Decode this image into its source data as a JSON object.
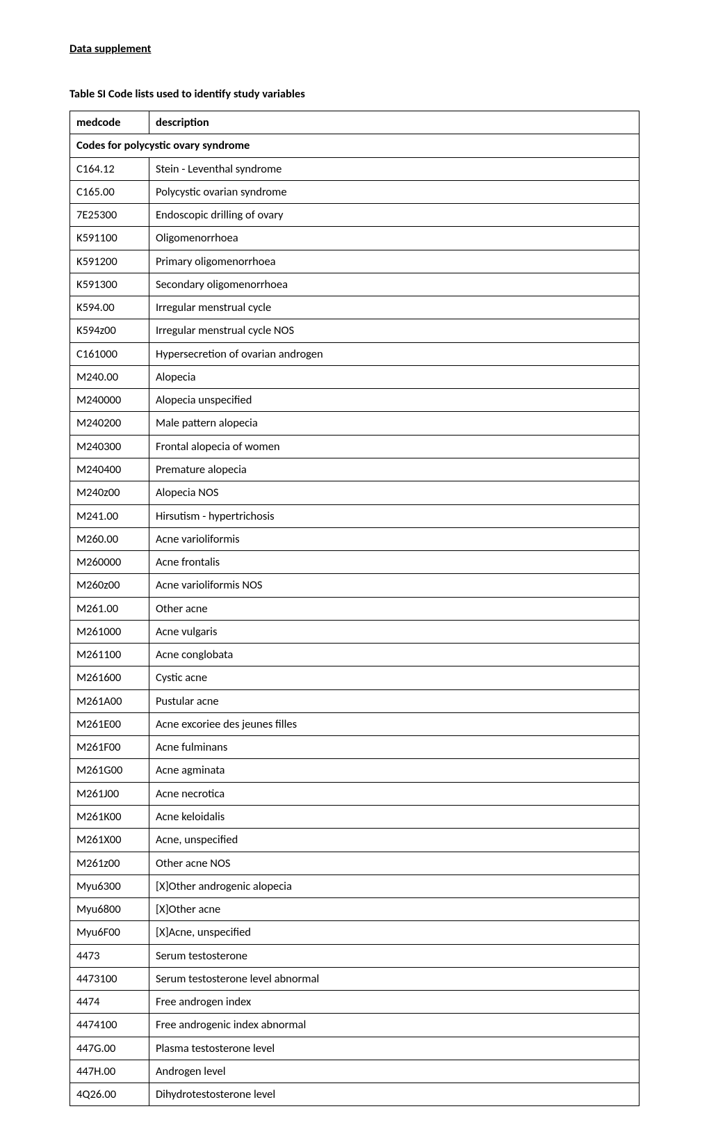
{
  "heading": "Data supplement",
  "table_title": "Table SI Code lists used to identify study variables",
  "header": {
    "col1": "medcode",
    "col2": "description"
  },
  "section_header": "Codes for polycystic ovary syndrome",
  "rows": [
    {
      "code": "C164.12",
      "desc": "Stein - Leventhal syndrome"
    },
    {
      "code": "C165.00",
      "desc": "Polycystic ovarian syndrome"
    },
    {
      "code": "7E25300",
      "desc": "Endoscopic drilling of ovary"
    },
    {
      "code": "K591100",
      "desc": "Oligomenorrhoea"
    },
    {
      "code": "K591200",
      "desc": "Primary oligomenorrhoea"
    },
    {
      "code": "K591300",
      "desc": "Secondary oligomenorrhoea"
    },
    {
      "code": "K594.00",
      "desc": "Irregular menstrual cycle"
    },
    {
      "code": "K594z00",
      "desc": "Irregular menstrual cycle NOS"
    },
    {
      "code": "C161000",
      "desc": "Hypersecretion of ovarian androgen"
    },
    {
      "code": "M240.00",
      "desc": "Alopecia"
    },
    {
      "code": "M240000",
      "desc": "Alopecia unspecified"
    },
    {
      "code": "M240200",
      "desc": "Male pattern alopecia"
    },
    {
      "code": "M240300",
      "desc": "Frontal alopecia of women"
    },
    {
      "code": "M240400",
      "desc": "Premature alopecia"
    },
    {
      "code": "M240z00",
      "desc": "Alopecia NOS"
    },
    {
      "code": "M241.00",
      "desc": "Hirsutism - hypertrichosis"
    },
    {
      "code": "M260.00",
      "desc": "Acne varioliformis"
    },
    {
      "code": "M260000",
      "desc": "Acne frontalis"
    },
    {
      "code": "M260z00",
      "desc": "Acne varioliformis NOS"
    },
    {
      "code": "M261.00",
      "desc": "Other acne"
    },
    {
      "code": "M261000",
      "desc": "Acne vulgaris"
    },
    {
      "code": "M261100",
      "desc": "Acne conglobata"
    },
    {
      "code": "M261600",
      "desc": "Cystic acne"
    },
    {
      "code": "M261A00",
      "desc": "Pustular acne"
    },
    {
      "code": "M261E00",
      "desc": "Acne excoriee des jeunes filles"
    },
    {
      "code": "M261F00",
      "desc": "Acne fulminans"
    },
    {
      "code": "M261G00",
      "desc": "Acne agminata"
    },
    {
      "code": "M261J00",
      "desc": "Acne necrotica"
    },
    {
      "code": "M261K00",
      "desc": "Acne keloidalis"
    },
    {
      "code": "M261X00",
      "desc": "Acne, unspecified"
    },
    {
      "code": "M261z00",
      "desc": "Other acne NOS"
    },
    {
      "code": "Myu6300",
      "desc": "[X]Other androgenic alopecia"
    },
    {
      "code": "Myu6800",
      "desc": "[X]Other acne"
    },
    {
      "code": "Myu6F00",
      "desc": "[X]Acne, unspecified"
    },
    {
      "code": "4473",
      "desc": "Serum testosterone"
    },
    {
      "code": "4473100",
      "desc": "Serum testosterone level abnormal"
    },
    {
      "code": "4474",
      "desc": "Free androgen index"
    },
    {
      "code": "4474100",
      "desc": "Free androgenic index abnormal"
    },
    {
      "code": "447G.00",
      "desc": "Plasma testosterone level"
    },
    {
      "code": "447H.00",
      "desc": "Androgen level"
    },
    {
      "code": "4Q26.00",
      "desc": "Dihydrotestosterone level"
    }
  ]
}
